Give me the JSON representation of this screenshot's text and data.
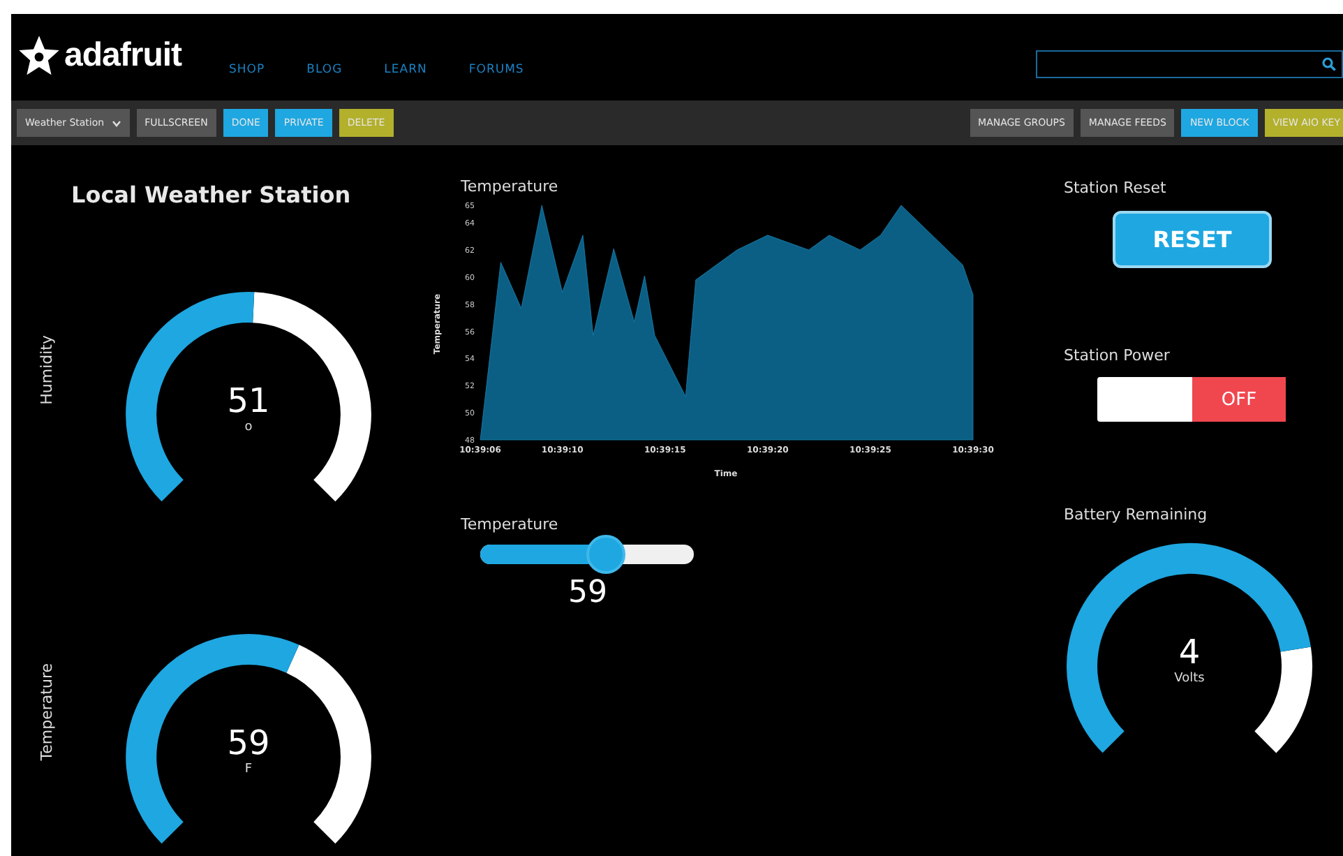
{
  "header": {
    "logo": "adafruit",
    "nav": [
      "SHOP",
      "BLOG",
      "LEARN",
      "FORUMS"
    ]
  },
  "toolbar": {
    "left": [
      {
        "label": "Weather Station",
        "kind": "dropdown",
        "color": "#555555"
      },
      {
        "label": "FULLSCREEN",
        "kind": "button",
        "color": "#555555"
      },
      {
        "label": "DONE",
        "kind": "button",
        "color": "#1ea7e1"
      },
      {
        "label": "PRIVATE",
        "kind": "button",
        "color": "#1ea7e1"
      },
      {
        "label": "DELETE",
        "kind": "button",
        "color": "#b3b02c"
      }
    ],
    "right": [
      {
        "label": "MANAGE GROUPS",
        "kind": "button",
        "color": "#555555"
      },
      {
        "label": "MANAGE FEEDS",
        "kind": "button",
        "color": "#555555"
      },
      {
        "label": "NEW BLOCK",
        "kind": "button",
        "color": "#1ea7e1"
      },
      {
        "label": "VIEW AIO KEY",
        "kind": "button",
        "color": "#b3b02c"
      }
    ]
  },
  "left_panel": {
    "title": "Local Weather Station",
    "gauges": [
      {
        "label": "Humidity",
        "value": "51",
        "unit": "o"
      },
      {
        "label": "Temperature",
        "value": "59",
        "unit": "F"
      }
    ]
  },
  "chart_panel": {
    "chart_data": {
      "type": "area",
      "title": "Temperature",
      "xlabel": "Time",
      "ylabel": "Temperature",
      "categories": [
        "10:39:06",
        null,
        null,
        null,
        null,
        null,
        null,
        null,
        "10:39:10",
        null,
        null,
        null,
        null,
        null,
        null,
        null,
        null,
        null,
        "10:39:15",
        null,
        null,
        null,
        null,
        null,
        null,
        null,
        null,
        null,
        "10:39:20",
        null,
        null,
        null,
        null,
        null,
        null,
        null,
        null,
        null,
        "10:39:25",
        null,
        null,
        null,
        null,
        null,
        null,
        null,
        null,
        null,
        "10:39:30"
      ],
      "series": [
        {
          "color": "#0b5f85",
          "values": [
            48,
            null,
            61.1,
            null,
            57.7,
            null,
            65.3,
            null,
            58.9,
            null,
            63.1,
            55.7,
            null,
            62.1,
            null,
            56.7,
            60.1,
            55.7,
            null,
            null,
            51.2,
            59.8,
            null,
            null,
            null,
            62,
            null,
            null,
            63.1,
            null,
            null,
            null,
            62,
            null,
            63.1,
            null,
            null,
            62,
            null,
            63.1,
            null,
            65.3,
            null,
            null,
            null,
            null,
            null,
            60.9,
            58.7
          ]
        }
      ],
      "ylim": [
        48,
        65.3
      ],
      "yticks": [
        48,
        50,
        52,
        54,
        56,
        58,
        60,
        62,
        64,
        {
          "value": 65.3,
          "label": "65"
        }
      ]
    }
  },
  "slider": {
    "label": "Temperature",
    "level": 0.59,
    "value": "59"
  },
  "reset": {
    "label": "Station Reset",
    "button": "RESET"
  },
  "power": {
    "label": "Station Power",
    "on": false,
    "state_text": "OFF"
  },
  "battery": {
    "label": "Battery Remaining",
    "value": "4",
    "unit": "Volts"
  }
}
